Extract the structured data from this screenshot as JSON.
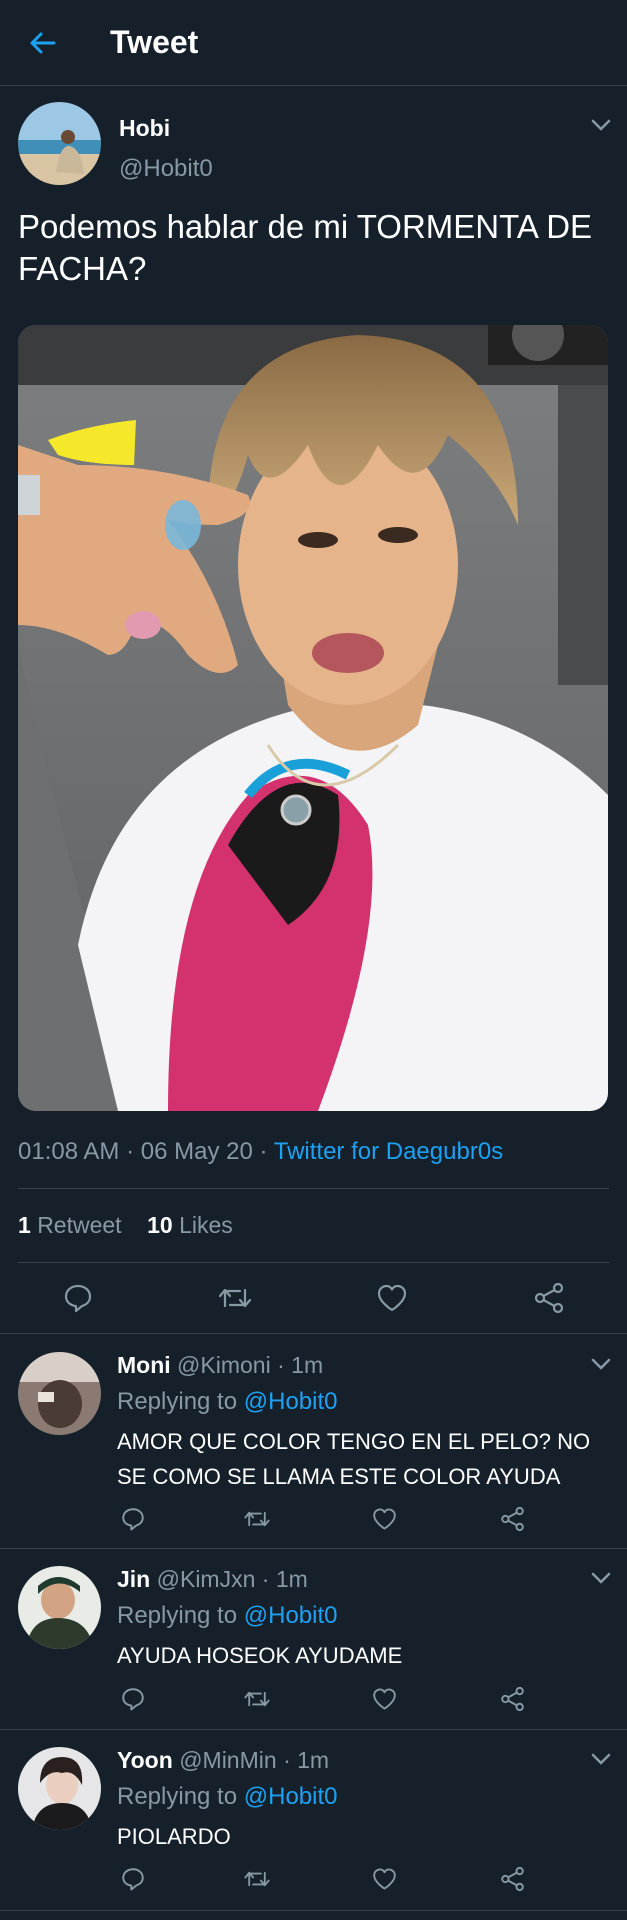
{
  "header": {
    "title": "Tweet",
    "back_icon": "arrow-left-icon"
  },
  "tweet": {
    "author_name": "Hobi",
    "author_handle": "@Hobit0",
    "text": "Podemos hablar de mi TORMENTA DE FACHA?",
    "time": "01:08 AM",
    "date": "06 May 20",
    "separator": "·",
    "source": "Twitter for Daegubr0s",
    "retweets_count": "1",
    "retweets_label": "Retweet",
    "likes_count": "10",
    "likes_label": "Likes"
  },
  "replies": [
    {
      "name": "Moni",
      "handle": "@Kimoni",
      "time": "1m",
      "replying_label": "Replying to",
      "replying_handle": "@Hobit0",
      "text": "AMOR QUE COLOR TENGO EN EL PELO? NO SE COMO SE LLAMA ESTE COLOR AYUDA"
    },
    {
      "name": "Jin",
      "handle": "@KimJxn",
      "time": "1m",
      "replying_label": "Replying to",
      "replying_handle": "@Hobit0",
      "text": "AYUDA HOSEOK AYUDAME"
    },
    {
      "name": "Yoon",
      "handle": "@MinMin",
      "time": "1m",
      "replying_label": "Replying to",
      "replying_handle": "@Hobit0",
      "text": "PIOLARDO"
    }
  ],
  "colors": {
    "background": "#15202b",
    "accent": "#1da1f2",
    "muted": "#8899a6",
    "divider": "#38444d"
  }
}
